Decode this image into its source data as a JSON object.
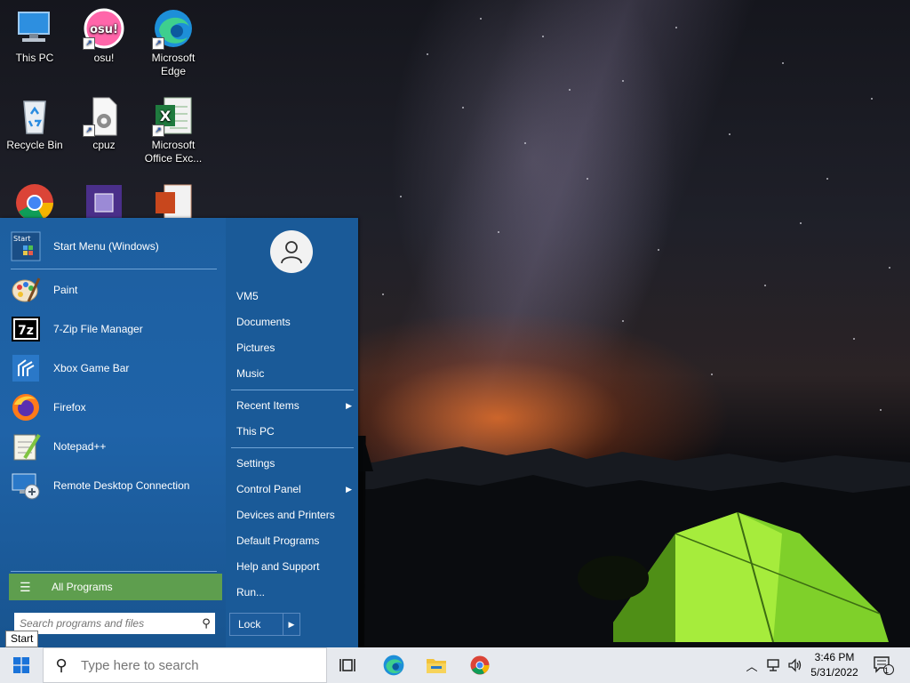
{
  "desktop": {
    "icons": [
      {
        "label": "This PC"
      },
      {
        "label": "osu!"
      },
      {
        "label": "Microsoft Edge"
      },
      {
        "label": "Recycle Bin"
      },
      {
        "label": "cpuz"
      },
      {
        "label": "Microsoft Office Exc..."
      }
    ]
  },
  "start_menu": {
    "header": {
      "label": "Start Menu (Windows)",
      "icon_text": "Start"
    },
    "pinned": [
      {
        "label": "Paint",
        "icon": "paint-icon"
      },
      {
        "label": "7-Zip File Manager",
        "icon": "7zip-icon",
        "icon_text": "7z"
      },
      {
        "label": "Xbox Game Bar",
        "icon": "xbox-game-bar-icon"
      },
      {
        "label": "Firefox",
        "icon": "firefox-icon"
      },
      {
        "label": "Notepad++",
        "icon": "notepadpp-icon"
      },
      {
        "label": "Remote Desktop Connection",
        "icon": "remote-desktop-icon"
      }
    ],
    "all_programs": "All Programs",
    "search_placeholder": "Search programs and files",
    "right": {
      "items": [
        {
          "label": "VM5"
        },
        {
          "label": "Documents"
        },
        {
          "label": "Pictures"
        },
        {
          "label": "Music"
        },
        {
          "label": "Recent Items",
          "submenu": true
        },
        {
          "label": "This PC"
        },
        {
          "label": "Settings"
        },
        {
          "label": "Control Panel",
          "submenu": true
        },
        {
          "label": "Devices and Printers"
        },
        {
          "label": "Default Programs"
        },
        {
          "label": "Help and Support"
        },
        {
          "label": "Run..."
        }
      ],
      "lock_label": "Lock"
    }
  },
  "tooltip": "Start",
  "taskbar": {
    "search_placeholder": "Type here to search",
    "apps": [
      "task-view-icon",
      "edge-icon",
      "file-explorer-icon",
      "chrome-icon"
    ],
    "clock": {
      "time": "3:46 PM",
      "date": "5/31/2022"
    },
    "notification_count": "1"
  },
  "colors": {
    "start_menu_bg": "#1f63a8",
    "all_programs_bg": "#5e9e4e",
    "taskbar_bg": "#e6e9ee"
  }
}
